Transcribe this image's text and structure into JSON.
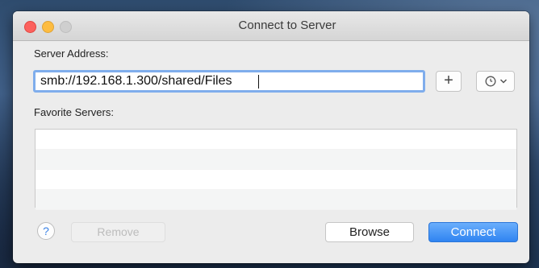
{
  "window": {
    "title": "Connect to Server"
  },
  "server_address": {
    "label": "Server Address:",
    "value": "smb://192.168.1.300/shared/Files"
  },
  "toolbar": {
    "add_label": "+",
    "recent_icon": "clock-icon",
    "recent_dropdown_icon": "chevron-down-icon"
  },
  "favorites": {
    "label": "Favorite Servers:",
    "items": []
  },
  "footer": {
    "help_label": "?",
    "remove_label": "Remove",
    "browse_label": "Browse",
    "connect_label": "Connect"
  },
  "colors": {
    "accent": "#2f84f1",
    "close": "#fc615d",
    "minimize": "#fdbc40",
    "zoom_inactive": "#cfcfcf"
  }
}
